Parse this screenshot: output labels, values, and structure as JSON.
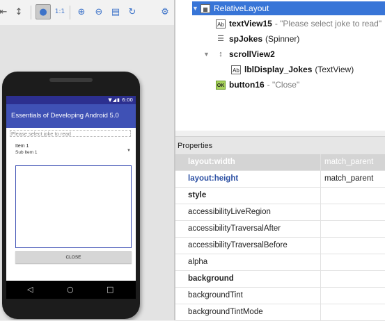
{
  "toolbar": {
    "icons": [
      "resize-left-icon",
      "resize-vertical-icon",
      "fit-icon",
      "one-to-one-icon",
      "zoom-in-icon",
      "zoom-out-icon",
      "page-icon",
      "refresh-icon",
      "settings-icon"
    ],
    "one_to_one_label": "1:1"
  },
  "device": {
    "status_time": "6:00",
    "app_title": "Essentials of Developing Android 5.0",
    "hint_text": "Please select joke to read",
    "spinner_item": "Item 1",
    "spinner_subitem": "Sub Item 1",
    "close_button": "CLOSE"
  },
  "tree": [
    {
      "name": "RelativeLayout",
      "desc": "",
      "icon": "relative-layout-icon",
      "selected": true
    },
    {
      "name": "textView15",
      "desc": "- \"Please select joke to read\"",
      "icon": "textview-icon"
    },
    {
      "name": "spJokes",
      "desc": "(Spinner)",
      "icon": "spinner-icon"
    },
    {
      "name": "scrollView2",
      "desc": "",
      "icon": "scrollview-icon"
    },
    {
      "name": "lblDisplay_Jokes",
      "desc": "(TextView)",
      "icon": "textview-icon"
    },
    {
      "name": "button16",
      "desc": "- \"Close\"",
      "icon": "button-icon"
    }
  ],
  "properties": {
    "title": "Properties",
    "rows": [
      {
        "key": "layout:width",
        "value": "match_parent"
      },
      {
        "key": "layout:height",
        "value": "match_parent"
      },
      {
        "key": "style",
        "value": ""
      },
      {
        "key": "accessibilityLiveRegion",
        "value": ""
      },
      {
        "key": "accessibilityTraversalAfter",
        "value": ""
      },
      {
        "key": "accessibilityTraversalBefore",
        "value": ""
      },
      {
        "key": "alpha",
        "value": ""
      },
      {
        "key": "background",
        "value": ""
      },
      {
        "key": "backgroundTint",
        "value": ""
      },
      {
        "key": "backgroundTintMode",
        "value": ""
      }
    ]
  },
  "colors": {
    "app_bar": "#3f51b5",
    "status_bar": "#2c2f8f",
    "tree_selection": "#3875d7",
    "property_selection": "#d4d4d4"
  }
}
